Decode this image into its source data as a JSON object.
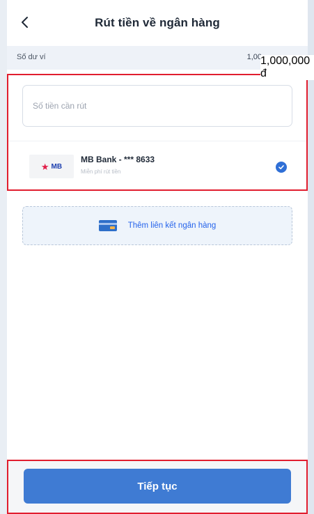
{
  "header": {
    "title": "Rút tiền về ngân hàng",
    "back_icon": "chevron-left-icon"
  },
  "balance": {
    "label": "Số dư ví",
    "value_partial": "1,00",
    "value_overlay": "1,000,000 đ"
  },
  "withdraw_form": {
    "amount_placeholder": "Số tiền cần rút"
  },
  "bank": {
    "logo_text": "MB",
    "name": "MB Bank - *** 8633",
    "subtitle": "Miễn phí rút tiền",
    "selected": true
  },
  "add_bank": {
    "label": "Thêm liên kết ngân hàng",
    "icon": "credit-card-icon"
  },
  "footer": {
    "continue_label": "Tiếp tục"
  },
  "colors": {
    "primary": "#3f7bd3",
    "highlight_border": "#e11d2e",
    "check": "#2f6fd6"
  }
}
